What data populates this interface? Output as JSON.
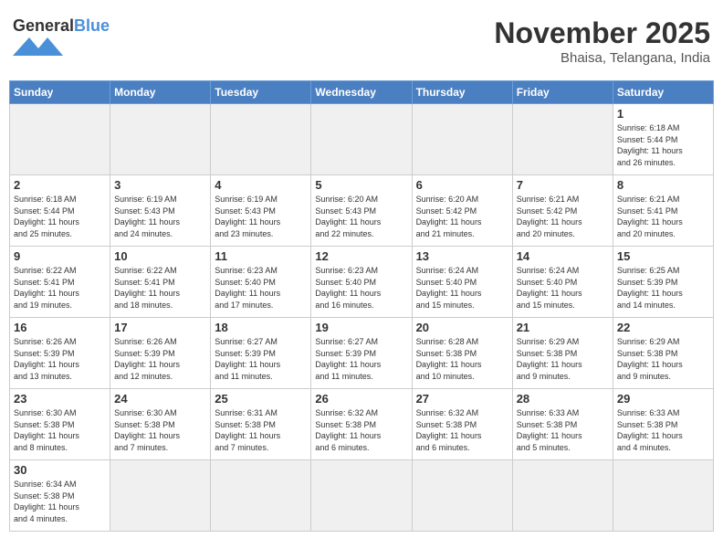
{
  "header": {
    "logo_general": "General",
    "logo_blue": "Blue",
    "month": "November 2025",
    "location": "Bhaisa, Telangana, India"
  },
  "weekdays": [
    "Sunday",
    "Monday",
    "Tuesday",
    "Wednesday",
    "Thursday",
    "Friday",
    "Saturday"
  ],
  "weeks": [
    [
      {
        "day": "",
        "info": ""
      },
      {
        "day": "",
        "info": ""
      },
      {
        "day": "",
        "info": ""
      },
      {
        "day": "",
        "info": ""
      },
      {
        "day": "",
        "info": ""
      },
      {
        "day": "",
        "info": ""
      },
      {
        "day": "1",
        "info": "Sunrise: 6:18 AM\nSunset: 5:44 PM\nDaylight: 11 hours\nand 26 minutes."
      }
    ],
    [
      {
        "day": "2",
        "info": "Sunrise: 6:18 AM\nSunset: 5:44 PM\nDaylight: 11 hours\nand 25 minutes."
      },
      {
        "day": "3",
        "info": "Sunrise: 6:19 AM\nSunset: 5:43 PM\nDaylight: 11 hours\nand 24 minutes."
      },
      {
        "day": "4",
        "info": "Sunrise: 6:19 AM\nSunset: 5:43 PM\nDaylight: 11 hours\nand 23 minutes."
      },
      {
        "day": "5",
        "info": "Sunrise: 6:20 AM\nSunset: 5:43 PM\nDaylight: 11 hours\nand 22 minutes."
      },
      {
        "day": "6",
        "info": "Sunrise: 6:20 AM\nSunset: 5:42 PM\nDaylight: 11 hours\nand 21 minutes."
      },
      {
        "day": "7",
        "info": "Sunrise: 6:21 AM\nSunset: 5:42 PM\nDaylight: 11 hours\nand 20 minutes."
      },
      {
        "day": "8",
        "info": "Sunrise: 6:21 AM\nSunset: 5:41 PM\nDaylight: 11 hours\nand 20 minutes."
      }
    ],
    [
      {
        "day": "9",
        "info": "Sunrise: 6:22 AM\nSunset: 5:41 PM\nDaylight: 11 hours\nand 19 minutes."
      },
      {
        "day": "10",
        "info": "Sunrise: 6:22 AM\nSunset: 5:41 PM\nDaylight: 11 hours\nand 18 minutes."
      },
      {
        "day": "11",
        "info": "Sunrise: 6:23 AM\nSunset: 5:40 PM\nDaylight: 11 hours\nand 17 minutes."
      },
      {
        "day": "12",
        "info": "Sunrise: 6:23 AM\nSunset: 5:40 PM\nDaylight: 11 hours\nand 16 minutes."
      },
      {
        "day": "13",
        "info": "Sunrise: 6:24 AM\nSunset: 5:40 PM\nDaylight: 11 hours\nand 15 minutes."
      },
      {
        "day": "14",
        "info": "Sunrise: 6:24 AM\nSunset: 5:40 PM\nDaylight: 11 hours\nand 15 minutes."
      },
      {
        "day": "15",
        "info": "Sunrise: 6:25 AM\nSunset: 5:39 PM\nDaylight: 11 hours\nand 14 minutes."
      }
    ],
    [
      {
        "day": "16",
        "info": "Sunrise: 6:26 AM\nSunset: 5:39 PM\nDaylight: 11 hours\nand 13 minutes."
      },
      {
        "day": "17",
        "info": "Sunrise: 6:26 AM\nSunset: 5:39 PM\nDaylight: 11 hours\nand 12 minutes."
      },
      {
        "day": "18",
        "info": "Sunrise: 6:27 AM\nSunset: 5:39 PM\nDaylight: 11 hours\nand 11 minutes."
      },
      {
        "day": "19",
        "info": "Sunrise: 6:27 AM\nSunset: 5:39 PM\nDaylight: 11 hours\nand 11 minutes."
      },
      {
        "day": "20",
        "info": "Sunrise: 6:28 AM\nSunset: 5:38 PM\nDaylight: 11 hours\nand 10 minutes."
      },
      {
        "day": "21",
        "info": "Sunrise: 6:29 AM\nSunset: 5:38 PM\nDaylight: 11 hours\nand 9 minutes."
      },
      {
        "day": "22",
        "info": "Sunrise: 6:29 AM\nSunset: 5:38 PM\nDaylight: 11 hours\nand 9 minutes."
      }
    ],
    [
      {
        "day": "23",
        "info": "Sunrise: 6:30 AM\nSunset: 5:38 PM\nDaylight: 11 hours\nand 8 minutes."
      },
      {
        "day": "24",
        "info": "Sunrise: 6:30 AM\nSunset: 5:38 PM\nDaylight: 11 hours\nand 7 minutes."
      },
      {
        "day": "25",
        "info": "Sunrise: 6:31 AM\nSunset: 5:38 PM\nDaylight: 11 hours\nand 7 minutes."
      },
      {
        "day": "26",
        "info": "Sunrise: 6:32 AM\nSunset: 5:38 PM\nDaylight: 11 hours\nand 6 minutes."
      },
      {
        "day": "27",
        "info": "Sunrise: 6:32 AM\nSunset: 5:38 PM\nDaylight: 11 hours\nand 6 minutes."
      },
      {
        "day": "28",
        "info": "Sunrise: 6:33 AM\nSunset: 5:38 PM\nDaylight: 11 hours\nand 5 minutes."
      },
      {
        "day": "29",
        "info": "Sunrise: 6:33 AM\nSunset: 5:38 PM\nDaylight: 11 hours\nand 4 minutes."
      }
    ],
    [
      {
        "day": "30",
        "info": "Sunrise: 6:34 AM\nSunset: 5:38 PM\nDaylight: 11 hours\nand 4 minutes."
      },
      {
        "day": "",
        "info": ""
      },
      {
        "day": "",
        "info": ""
      },
      {
        "day": "",
        "info": ""
      },
      {
        "day": "",
        "info": ""
      },
      {
        "day": "",
        "info": ""
      },
      {
        "day": "",
        "info": ""
      }
    ]
  ]
}
